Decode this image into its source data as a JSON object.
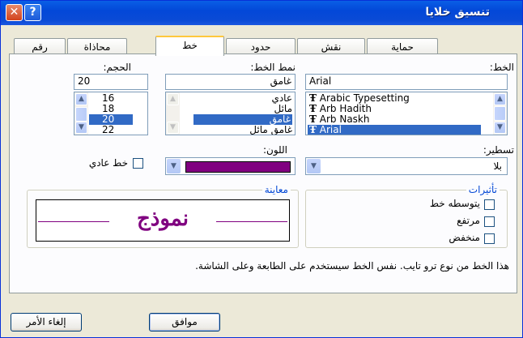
{
  "window": {
    "title": "تنسيق خلايا",
    "help_label": "?",
    "close_label": "✕"
  },
  "tabs": [
    {
      "label": "رقم",
      "active": false
    },
    {
      "label": "محاذاة",
      "active": false
    },
    {
      "label": "خط",
      "active": true
    },
    {
      "label": "حدود",
      "active": false
    },
    {
      "label": "نقش",
      "active": false
    },
    {
      "label": "حماية",
      "active": false
    }
  ],
  "font": {
    "label": "الخط:",
    "value": "Arial",
    "items": [
      "Arabic Typesetting",
      "Arb Hadith",
      "Arb Naskh",
      "Arial"
    ],
    "selected": "Arial",
    "item_icon": "truetype-font-icon"
  },
  "style": {
    "label": "نمط الخط:",
    "value": "غامق",
    "items": [
      "عادي",
      "مائل",
      "غامق",
      "غامق مائل"
    ],
    "selected": "غامق"
  },
  "size": {
    "label": "الحجم:",
    "value": "20",
    "items": [
      "16",
      "18",
      "20",
      "22"
    ],
    "selected": "20"
  },
  "underline": {
    "label": "تسطير:",
    "value": "بلا"
  },
  "color": {
    "label": "اللون:",
    "value_hex": "#800080"
  },
  "normal_font": {
    "label": "خط عادي",
    "checked": false
  },
  "effects": {
    "title": "تأثيرات",
    "items": [
      {
        "label": "يتوسطه خط",
        "checked": false
      },
      {
        "label": "مرتفع",
        "checked": false
      },
      {
        "label": "منخفض",
        "checked": false
      }
    ]
  },
  "preview": {
    "title": "معاينة",
    "sample": "نموذج",
    "color": "#800080"
  },
  "info_text": "هذا الخط من نوع ترو تايب. نفس الخط سيستخدم على الطابعة وعلى الشاشة.",
  "buttons": {
    "ok": "موافق",
    "cancel": "إلغاء الأمر"
  }
}
